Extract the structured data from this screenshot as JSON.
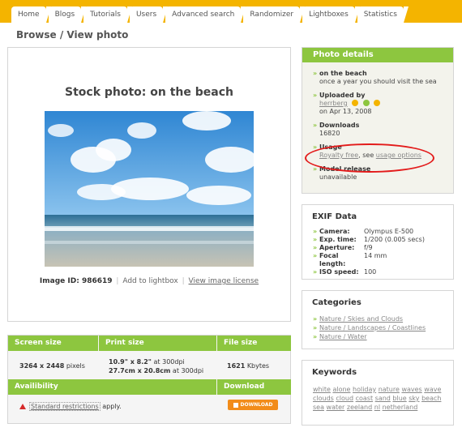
{
  "nav": {
    "tabs": [
      "Home",
      "Blogs",
      "Tutorials",
      "Users",
      "Advanced search",
      "Randomizer",
      "Lightboxes",
      "Statistics"
    ]
  },
  "page_title": "Browse / View photo",
  "photo": {
    "title": "Stock photo: on the beach",
    "image_id_label": "Image ID: 986619",
    "add_to_lightbox": "Add to lightbox",
    "view_license": "View image license"
  },
  "info_table": {
    "screen_size_header": "Screen size",
    "print_size_header": "Print size",
    "file_size_header": "File size",
    "screen_size_value": "3264 x 2448",
    "screen_size_unit": "pixels",
    "print_size_line1": "10.9\" x 8.2\"",
    "print_size_line1_suffix": "at 300dpi",
    "print_size_line2": "27.7cm x 20.8cm",
    "print_size_line2_suffix": "at 300dpi",
    "file_size_value": "1621",
    "file_size_unit": "Kbytes",
    "availability_header": "Availibility",
    "download_header": "Download",
    "restrictions_link": "Standard restrictions",
    "restrictions_suffix": "apply.",
    "download_button": "DOWNLOAD"
  },
  "photo_details": {
    "header": "Photo details",
    "title_label": "on the beach",
    "title_desc": "once a year you should visit the sea",
    "uploaded_by_label": "Uploaded by",
    "uploader": "herrberg",
    "upload_date": "on Apr 13, 2008",
    "downloads_label": "Downloads",
    "downloads_value": "16820",
    "usage_label": "Usage",
    "usage_link": "Royalty free",
    "usage_see": ", see",
    "usage_options": "usage options",
    "model_release_label": "Model release",
    "model_release_value": "unavailable"
  },
  "exif": {
    "header": "EXIF Data",
    "rows": [
      {
        "k": "Camera:",
        "v": "Olympus E-500"
      },
      {
        "k": "Exp. time:",
        "v": "1/200 (0.005 secs)"
      },
      {
        "k": "Aperture:",
        "v": "f/9"
      },
      {
        "k": "Focal length:",
        "v": "14 mm"
      },
      {
        "k": "ISO speed:",
        "v": "100"
      }
    ]
  },
  "categories": {
    "header": "Categories",
    "items": [
      "Nature / Skies and Clouds",
      "Nature / Landscapes / Coastlines",
      "Nature / Water"
    ]
  },
  "keywords": {
    "header": "Keywords",
    "items": [
      "white",
      "alone",
      "holiday",
      "nature",
      "waves",
      "wave",
      "clouds",
      "cloud",
      "coast",
      "sand",
      "blue",
      "sky",
      "beach",
      "sea",
      "water",
      "zeeland",
      "nl",
      "netherland"
    ]
  },
  "colors": {
    "nav_bg": "#f4b400",
    "accent_green": "#8dc63f",
    "download_orange": "#f28c1a",
    "highlight_red": "#e31b1b"
  }
}
